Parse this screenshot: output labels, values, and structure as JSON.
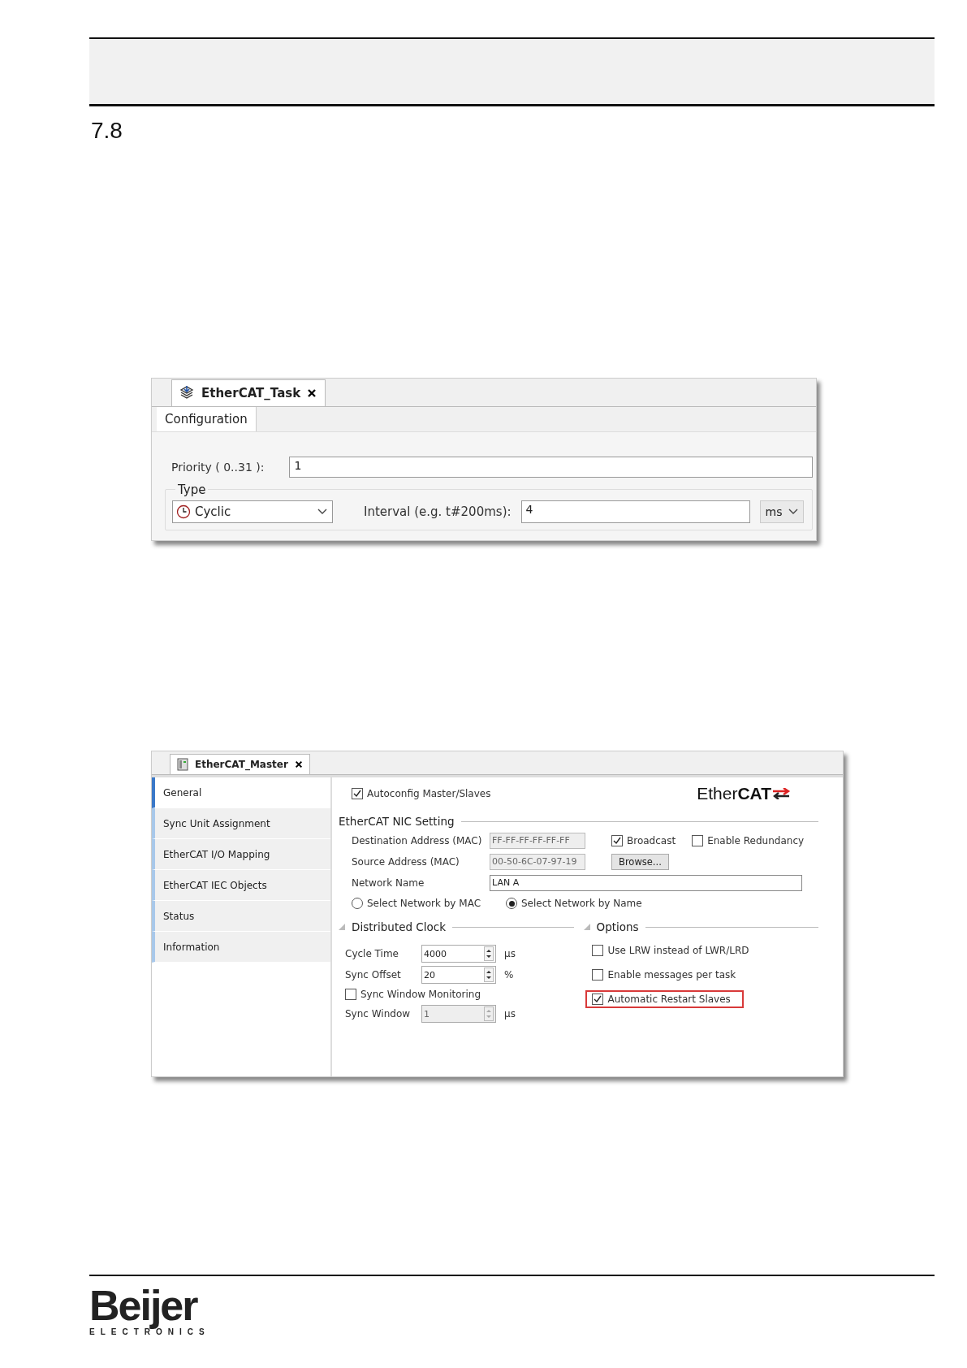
{
  "section_number": "7.8",
  "task_editor": {
    "tab_title": "EtherCAT_Task",
    "subtab": "Configuration",
    "priority": {
      "label": "Priority ( 0..31  ):",
      "value": "1"
    },
    "type_group": {
      "title": "Type",
      "type_value": "Cyclic",
      "interval_label": "Interval (e.g. t#200ms):",
      "interval_value": "4",
      "unit": "ms"
    }
  },
  "master_editor": {
    "tab_title": "EtherCAT_Master",
    "nav": [
      {
        "label": "General",
        "selected": true
      },
      {
        "label": "Sync Unit Assignment",
        "selected": false
      },
      {
        "label": "EtherCAT I/O Mapping",
        "selected": false
      },
      {
        "label": "EtherCAT IEC Objects",
        "selected": false
      },
      {
        "label": "Status",
        "selected": false
      },
      {
        "label": "Information",
        "selected": false
      }
    ],
    "autoconfig": {
      "label": "Autoconfig Master/Slaves",
      "checked": true
    },
    "logo": "Ether**CAT**",
    "nic_setting": {
      "title": "EtherCAT NIC Setting",
      "destination": {
        "label": "Destination Address (MAC)",
        "value": "FF-FF-FF-FF-FF-FF"
      },
      "broadcast": {
        "label": "Broadcast",
        "checked": true
      },
      "redundancy": {
        "label": "Enable Redundancy",
        "checked": false
      },
      "source": {
        "label": "Source Address (MAC)",
        "value": "00-50-6C-07-97-19"
      },
      "browse": "Browse...",
      "network_name": {
        "label": "Network Name",
        "value": "LAN A"
      },
      "radios": [
        {
          "label": "Select Network by MAC",
          "selected": false
        },
        {
          "label": "Select Network by Name",
          "selected": true
        }
      ]
    },
    "distributed_clock": {
      "title": "Distributed Clock",
      "items": [
        {
          "kind": "spin",
          "label": "Cycle Time",
          "value": "4000",
          "unit": "µs",
          "disabled": false
        },
        {
          "kind": "spin",
          "label": "Sync Offset",
          "value": "20",
          "unit": "%",
          "disabled": false
        },
        {
          "kind": "check",
          "label": "Sync Window Monitoring",
          "checked": false
        },
        {
          "kind": "spin",
          "label": "Sync Window",
          "value": "1",
          "unit": "µs",
          "disabled": true
        }
      ]
    },
    "options": {
      "title": "Options",
      "items": [
        {
          "label": "Use LRW instead of LWR/LRD",
          "checked": false,
          "highlighted": false
        },
        {
          "label": "Enable messages per task",
          "checked": false,
          "highlighted": false
        },
        {
          "label": "Automatic Restart Slaves",
          "checked": true,
          "highlighted": true
        }
      ]
    }
  },
  "footer_logo": {
    "name": "Beijer",
    "tagline": "ELECTRONICS"
  }
}
